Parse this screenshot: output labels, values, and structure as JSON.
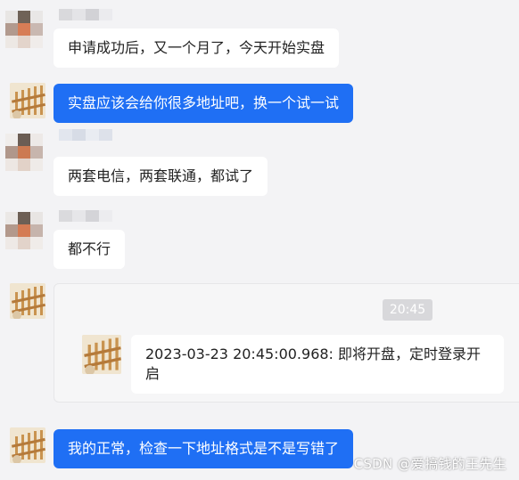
{
  "messages": [
    {
      "text": "申请成功后，又一个月了，今天开始实盘"
    },
    {
      "text": "实盘应该会给你很多地址吧，换一个试一试"
    },
    {
      "text": "两套电信，两套联通，都试了"
    },
    {
      "text": "都不行"
    },
    {
      "text": "我的正常，检查一下地址格式是不是写错了"
    }
  ],
  "quoted": {
    "time": "20:45",
    "text": "2023-03-23 20:45:00.968: 即将开盘，定时登录开启"
  },
  "watermark": "CSDN @爱搞钱的王先生",
  "colors": {
    "background": "#f3f3f5",
    "bubble_left": "#ffffff",
    "bubble_right": "#1f6ff4",
    "text_dark": "#222222"
  },
  "icons": {
    "avatar_other": "pixelated-avatar",
    "avatar_self": "fence-avatar"
  }
}
